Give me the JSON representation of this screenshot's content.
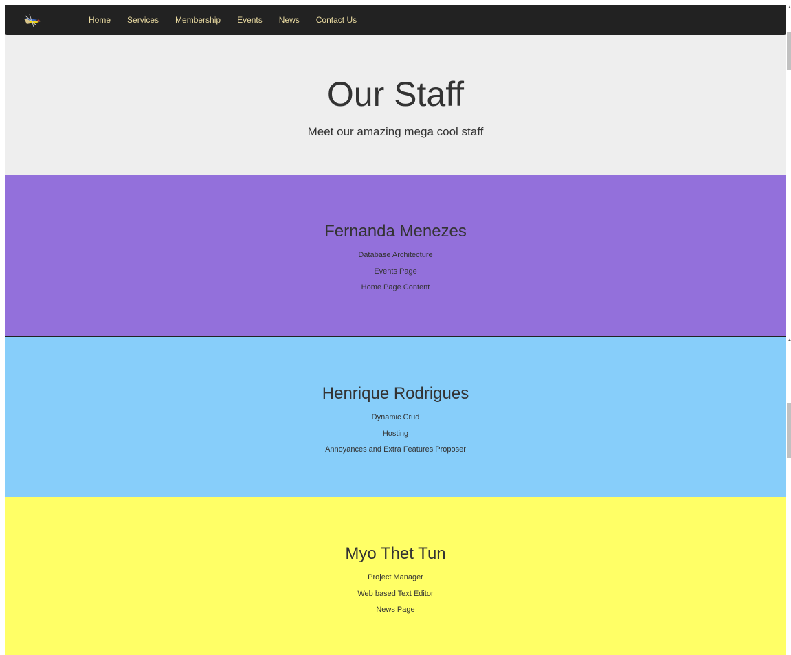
{
  "navbar": {
    "logo_icon": "hang-glider-logo-icon",
    "links": [
      "Home",
      "Services",
      "Membership",
      "Events",
      "News",
      "Contact Us"
    ]
  },
  "hero": {
    "title": "Our Staff",
    "subtitle": "Meet our amazing mega cool staff"
  },
  "staff": [
    {
      "name": "Fernanda Menezes",
      "roles": [
        "Database Architecture",
        "Events Page",
        "Home Page Content"
      ],
      "background": "#9370db"
    },
    {
      "name": "Henrique Rodrigues",
      "roles": [
        "Dynamic Crud",
        "Hosting",
        "Annoyances and Extra Features Proposer"
      ],
      "background": "#87cefa"
    },
    {
      "name": "Myo Thet Tun",
      "roles": [
        "Project Manager",
        "Web based Text Editor",
        "News Page"
      ],
      "background": "#ffff66"
    }
  ],
  "colors": {
    "navbar_bg": "#222222",
    "nav_link": "#e8d9a0",
    "hero_bg": "#eeeeee",
    "text": "#333333"
  }
}
